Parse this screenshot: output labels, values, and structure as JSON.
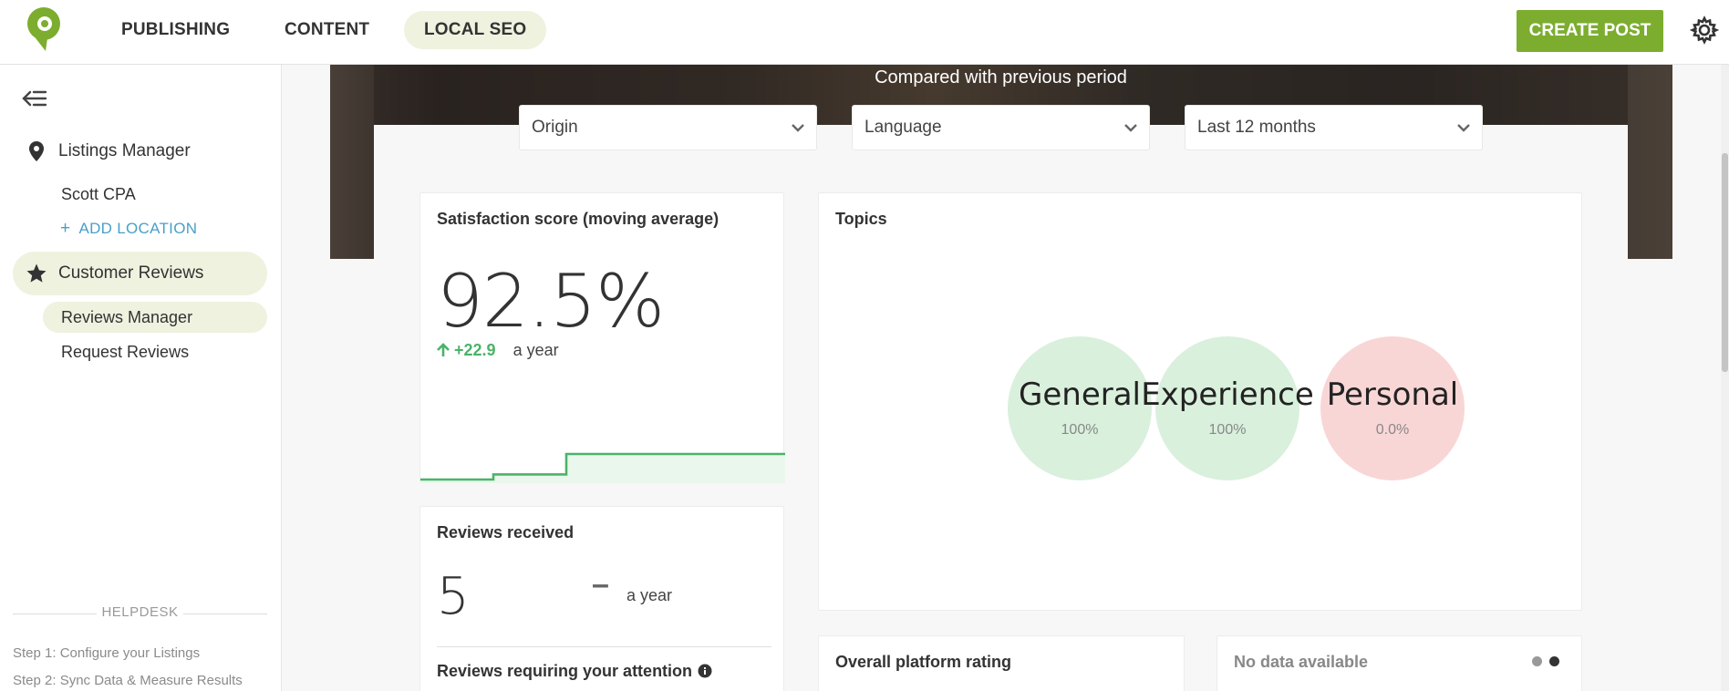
{
  "topbar": {
    "nav": [
      "PUBLISHING",
      "CONTENT",
      "LOCAL SEO"
    ],
    "active_nav": "LOCAL SEO",
    "create_post": "CREATE POST",
    "brand_color": "#7cad2f"
  },
  "sidebar": {
    "listings_manager": "Listings Manager",
    "location": "Scott CPA",
    "add_location": "ADD LOCATION",
    "customer_reviews": "Customer Reviews",
    "reviews_manager": "Reviews Manager",
    "request_reviews": "Request Reviews",
    "helpdesk": "HELPDESK",
    "help_links": [
      "Step 1: Configure your Listings",
      "Step 2: Sync Data & Measure Results"
    ]
  },
  "main": {
    "compared": "Compared with previous period",
    "filters": {
      "origin": "Origin",
      "language": "Language",
      "period": "Last 12 months"
    },
    "satisfaction": {
      "title": "Satisfaction score (moving average)",
      "score": "92.5%",
      "delta": "+22.9",
      "delta_period": "a year",
      "trend": [
        0,
        0,
        0.2,
        0.2,
        1,
        1,
        1,
        1,
        1,
        1,
        1
      ]
    },
    "topics": {
      "title": "Topics",
      "items": [
        {
          "name": "General",
          "pct": "100%",
          "color": "#d9f0dc"
        },
        {
          "name": "Experience",
          "pct": "100%",
          "color": "#d9f0dc"
        },
        {
          "name": "Personal",
          "pct": "0.0%",
          "color": "#f9d6d6"
        }
      ]
    },
    "reviews_received": {
      "title": "Reviews received",
      "count": "5",
      "delta": "–",
      "period": "a year",
      "attention": "Reviews requiring your attention"
    },
    "overall_rating": {
      "title": "Overall platform rating"
    },
    "no_data": "No data available"
  }
}
